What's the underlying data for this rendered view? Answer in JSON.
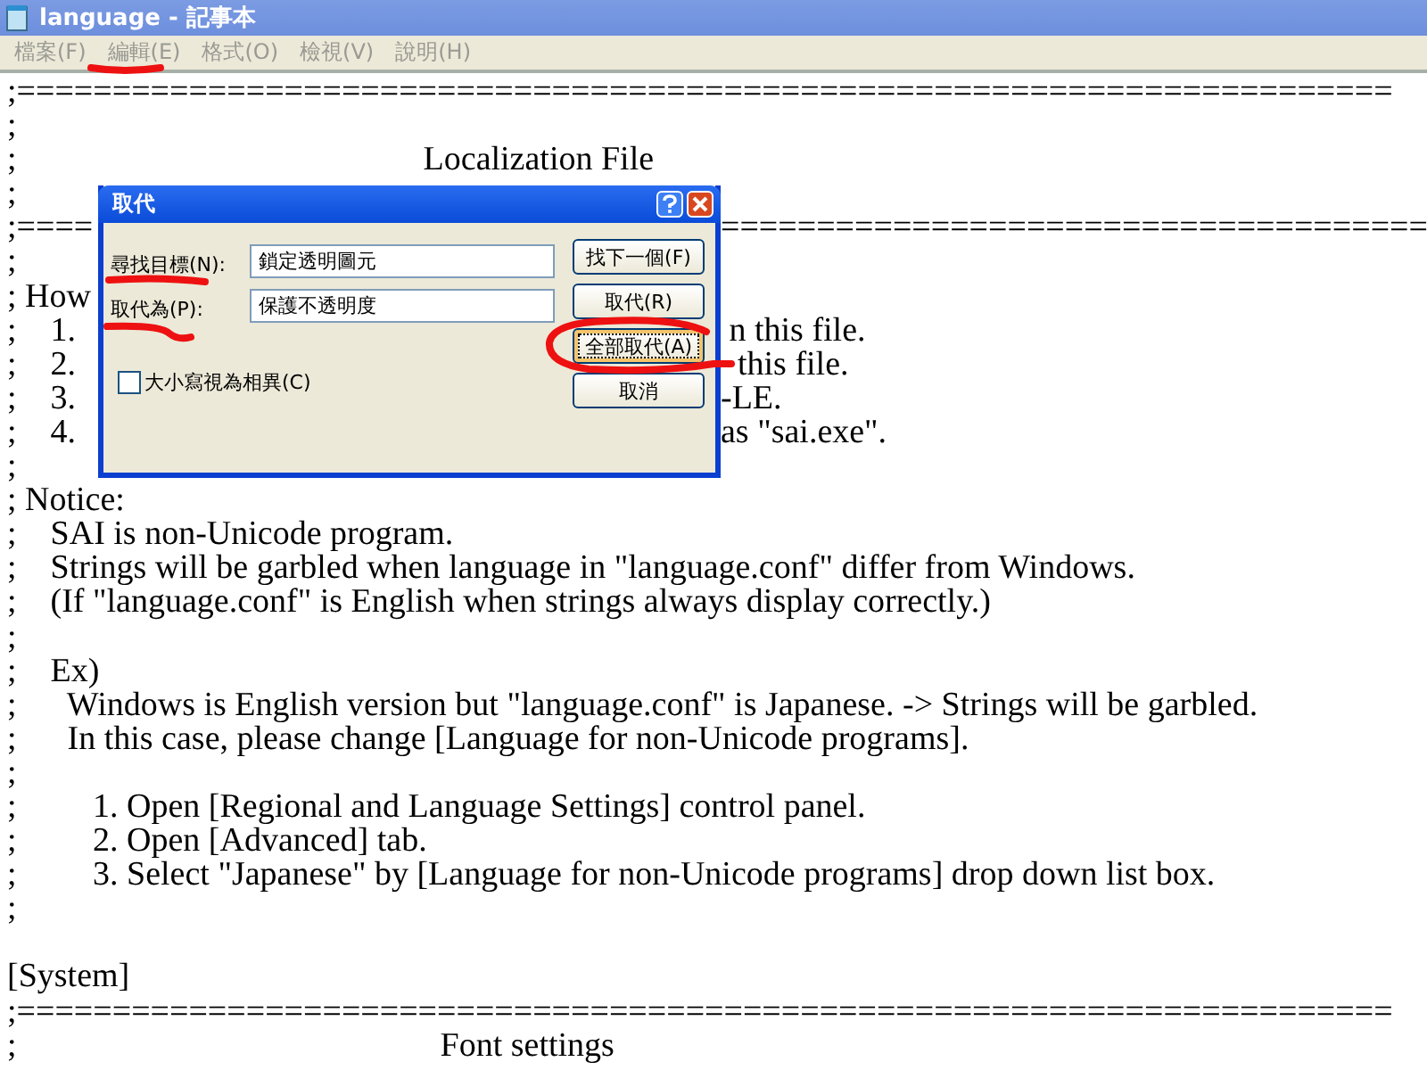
{
  "window": {
    "title": "language - 記事本"
  },
  "menu": [
    "檔案(F)",
    "編輯(E)",
    "格式(O)",
    "檢視(V)",
    "說明(H)"
  ],
  "lines": [
    {
      "kind": "text",
      "text": ";========================================================================"
    },
    {
      "kind": "text",
      "text": ";"
    },
    {
      "kind": "text",
      "text": ";                                                Localization File"
    },
    {
      "kind": "text",
      "text": ";"
    },
    {
      "kind": "text",
      "text": ";====",
      "tail": "====================================="
    },
    {
      "kind": "text",
      "text": ";"
    },
    {
      "kind": "text",
      "text": "; How"
    },
    {
      "kind": "text",
      "text": ";    1.",
      "tail": " n this file."
    },
    {
      "kind": "text",
      "text": ";    2.",
      "tail": "  this file."
    },
    {
      "kind": "text",
      "text": ";    3.",
      "tail": "-LE."
    },
    {
      "kind": "text",
      "text": ";    4.",
      "tail": "as \"sai.exe\"."
    },
    {
      "kind": "text",
      "text": ";"
    },
    {
      "kind": "text",
      "text": "; Notice:"
    },
    {
      "kind": "text",
      "text": ";    SAI is non-Unicode program."
    },
    {
      "kind": "text",
      "text": ";    Strings will be garbled when language in \"language.conf\" differ from Windows."
    },
    {
      "kind": "text",
      "text": ";    (If \"language.conf\" is English when strings always display correctly.)"
    },
    {
      "kind": "text",
      "text": ";"
    },
    {
      "kind": "text",
      "text": ";    Ex)"
    },
    {
      "kind": "text",
      "text": ";      Windows is English version but \"language.conf\" is Japanese. -> Strings will be garbled."
    },
    {
      "kind": "text",
      "text": ";      In this case, please change [Language for non-Unicode programs]."
    },
    {
      "kind": "text",
      "text": ";"
    },
    {
      "kind": "text",
      "text": ";         1. Open [Regional and Language Settings] control panel."
    },
    {
      "kind": "text",
      "text": ";         2. Open [Advanced] tab."
    },
    {
      "kind": "text",
      "text": ";         3. Select \"Japanese\" by [Language for non-Unicode programs] drop down list box."
    },
    {
      "kind": "text",
      "text": ";"
    },
    {
      "kind": "empty"
    },
    {
      "kind": "text",
      "text": "[System]"
    },
    {
      "kind": "text",
      "text": ";========================================================================"
    },
    {
      "kind": "text",
      "text": ";                                                  Font settings"
    }
  ],
  "dialog": {
    "title": "取代",
    "fields": [
      {
        "label": "尋找目標(N):",
        "value": "鎖定透明圖元"
      },
      {
        "label": "取代為(P):",
        "value": "保護不透明度"
      }
    ],
    "buttons": [
      {
        "label": "找下一個(F)",
        "focused": false
      },
      {
        "label": "取代(R)",
        "focused": false
      },
      {
        "label": "全部取代(A)",
        "focused": true
      },
      {
        "label": "取消",
        "focused": false
      }
    ],
    "checkbox": {
      "label": "大小寫視為相異(C)",
      "checked": false
    }
  }
}
